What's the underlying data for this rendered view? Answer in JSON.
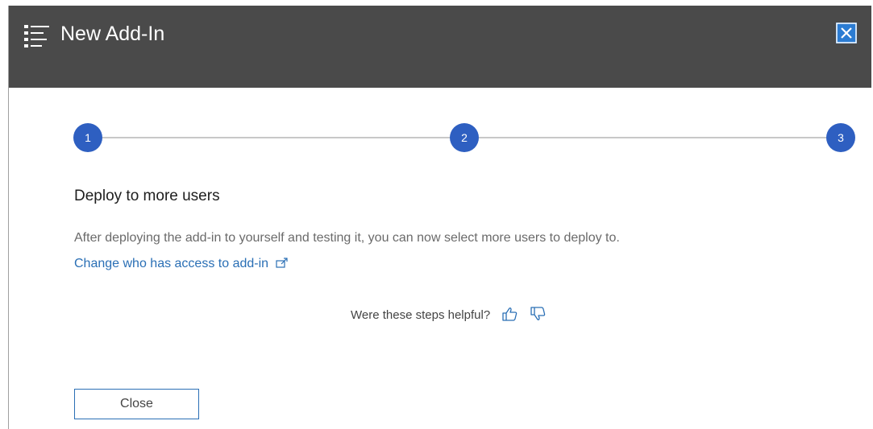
{
  "header": {
    "title": "New Add-In",
    "icon": "list-icon",
    "close_icon": "close-icon",
    "background": "#4a4a4a",
    "close_color": "#2b7cd3"
  },
  "stepper": {
    "steps": [
      {
        "label": "1"
      },
      {
        "label": "2"
      },
      {
        "label": "3"
      }
    ],
    "current_step": 3,
    "step_color": "#2e5fc1"
  },
  "content": {
    "title": "Deploy to more users",
    "description": "After deploying the add-in to yourself and testing it, you can now select more users to deploy to.",
    "link_label": "Change who has access to add-in",
    "link_icon": "external-link-icon"
  },
  "feedback": {
    "prompt": "Were these steps helpful?",
    "thumbs_up_icon": "thumbs-up-icon",
    "thumbs_down_icon": "thumbs-down-icon"
  },
  "footer": {
    "close_label": "Close"
  }
}
